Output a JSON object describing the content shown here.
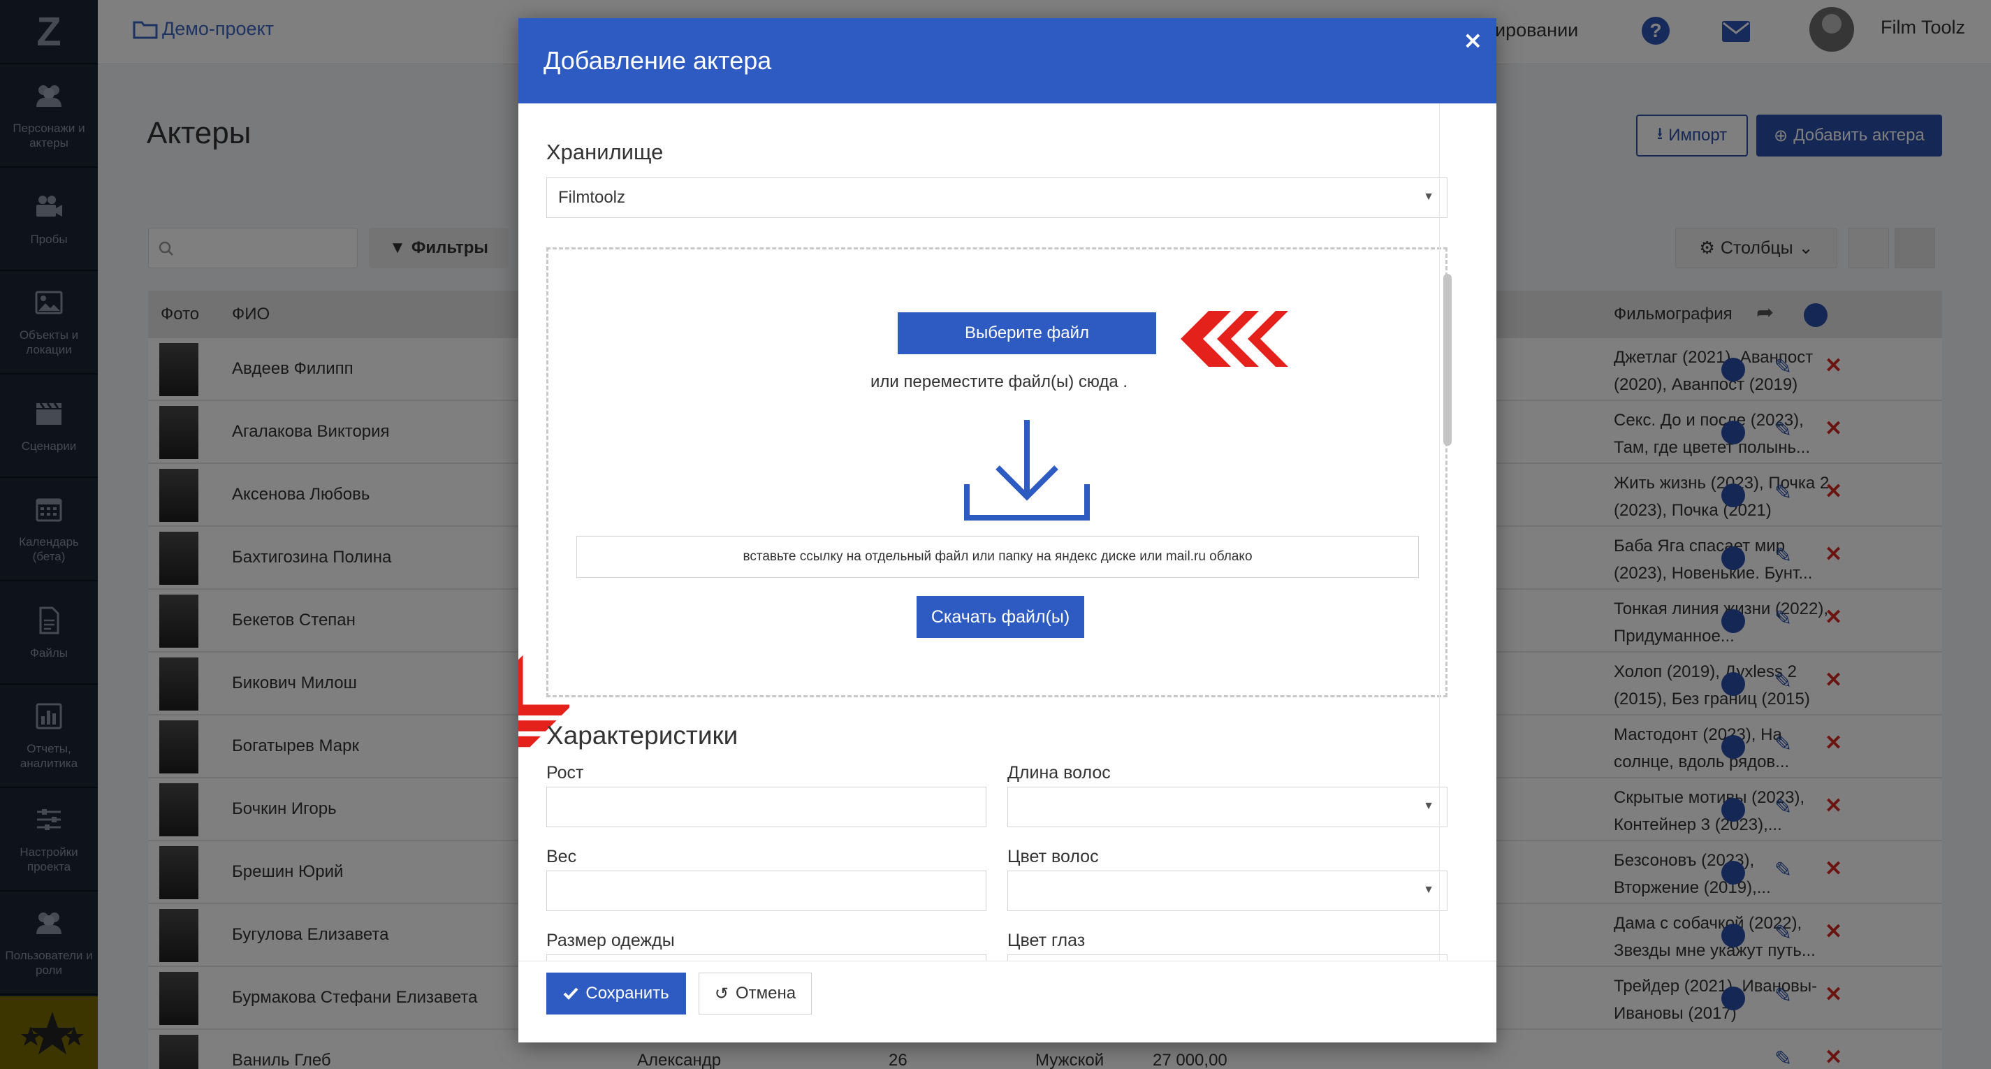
{
  "sidebar": {
    "logo": "Z",
    "items": [
      {
        "label": "Персонажи и актеры",
        "icon": "users-icon"
      },
      {
        "label": "Пробы",
        "icon": "video-camera-icon"
      },
      {
        "label": "Объекты и локации",
        "icon": "image-icon"
      },
      {
        "label": "Сценарии",
        "icon": "clapperboard-icon"
      },
      {
        "label": "Календарь (бета)",
        "icon": "calendar-icon"
      },
      {
        "label": "Файлы",
        "icon": "file-icon"
      },
      {
        "label": "Отчеты, аналитика",
        "icon": "bar-chart-icon"
      },
      {
        "label": "Настройки проекта",
        "icon": "sliders-icon"
      },
      {
        "label": "Пользователи и роли",
        "icon": "users-icon"
      }
    ]
  },
  "topbar": {
    "project": "Демо-проект",
    "schedule_partial": "ировании",
    "help": "?",
    "user_name": "Film Toolz"
  },
  "page": {
    "title": "Актеры",
    "import_label": "Импорт",
    "add_actor_label": "Добавить актера",
    "filters_label": "Фильтры",
    "columns_label": "Столбцы",
    "columns": {
      "photo": "Фото",
      "name": "ФИО",
      "filmography": "Фильмография"
    }
  },
  "actors": [
    {
      "name": "Авдеев Филипп",
      "film": "Джетлаг (2021), Аванпост (2020), Аванпост (2019)"
    },
    {
      "name": "Агалакова Виктория",
      "film": "Секс. До и после (2023), Там, где цветет полынь..."
    },
    {
      "name": "Аксенова Любовь",
      "film": "Жить жизнь (2023), Почка 2 (2023), Почка (2021)"
    },
    {
      "name": "Бахтигозина Полина",
      "film": "Баба Яга спасает мир (2023), Новенькие. Бунт..."
    },
    {
      "name": "Бекетов Степан",
      "film": "Тонкая линия жизни (2022), Придуманное..."
    },
    {
      "name": "Бикович Милош",
      "film": "Холоп (2019), Дуxless 2 (2015), Без границ (2015)"
    },
    {
      "name": "Богатырев Марк",
      "film": "Мастодонт (2023), На солнце, вдоль рядов..."
    },
    {
      "name": "Бочкин Игорь",
      "film": "Скрытые мотивы (2023), Контейнер 3 (2023),..."
    },
    {
      "name": "Брешин Юрий",
      "film": "Безсоновъ (2023), Вторжение (2019),..."
    },
    {
      "name": "Бугулова Елизавета",
      "film": "Дама с собачкой (2022), Звезды мне укажут путь..."
    },
    {
      "name": "Бурмакова Стефани Елизавета",
      "film": "Трейдер (2021), Ивановы-Ивановы (2017)"
    },
    {
      "name": "Ваниль Глеб",
      "film": "",
      "patronymic": "Александр",
      "age": "26",
      "gender": "Мужской",
      "fee": "27 000,00"
    }
  ],
  "modal": {
    "title": "Добавление актера",
    "close": "×",
    "storage_label": "Хранилище",
    "storage_value": "Filmtoolz",
    "choose_file": "Выберите файл",
    "drop_hint": "или переместите файл(ы) сюда .",
    "link_placeholder": "вставьте ссылку на отдельный файл или папку на яндекс диске или mail.ru облако",
    "download_label": "Скачать файл(ы)",
    "characteristics_title": "Характеристики",
    "height_label": "Рост",
    "hair_length_label": "Длина волос",
    "weight_label": "Вес",
    "hair_color_label": "Цвет волос",
    "clothing_size_label": "Размер одежды",
    "eye_color_label": "Цвет глаз",
    "save_label": "Сохранить",
    "cancel_label": "Отмена"
  },
  "colors": {
    "primary": "#2e5bc1",
    "sidebar": "#1b2436",
    "danger": "#d6281e",
    "arrow": "#e4211b"
  }
}
